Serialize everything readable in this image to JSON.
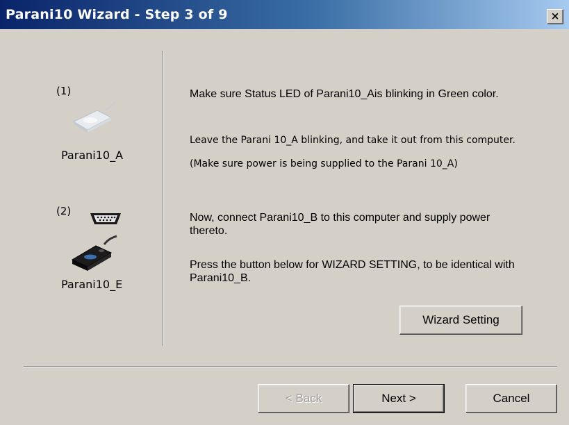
{
  "window": {
    "title": "Parani10 Wizard - Step 3 of 9",
    "close_label": "×"
  },
  "left_panel": {
    "step1_number": "(1)",
    "step1_device_label": "Parani10_A",
    "step2_number": "(2)",
    "step2_device_label": "Parani10_E"
  },
  "instructions": {
    "para1": "Make sure Status LED of Parani10_Ais blinking in Green color.",
    "para2_line1": "Leave the Parani 10_A blinking, and take it out from this computer.",
    "para2_line2": "(Make sure power is being supplied to the Parani 10_A)",
    "para3": "Now, connect Parani10_B to this computer and supply power thereto.",
    "para4": "Press the button below for WIZARD SETTING, to be identical with Parani10_B."
  },
  "buttons": {
    "wizard_setting": "Wizard Setting",
    "back": "< Back",
    "next": "Next >",
    "cancel": "Cancel"
  },
  "icons": {
    "device_a": "parani-adapter-icon",
    "serial_port": "serial-port-icon",
    "device_b": "parani-adapter-dark-icon"
  }
}
